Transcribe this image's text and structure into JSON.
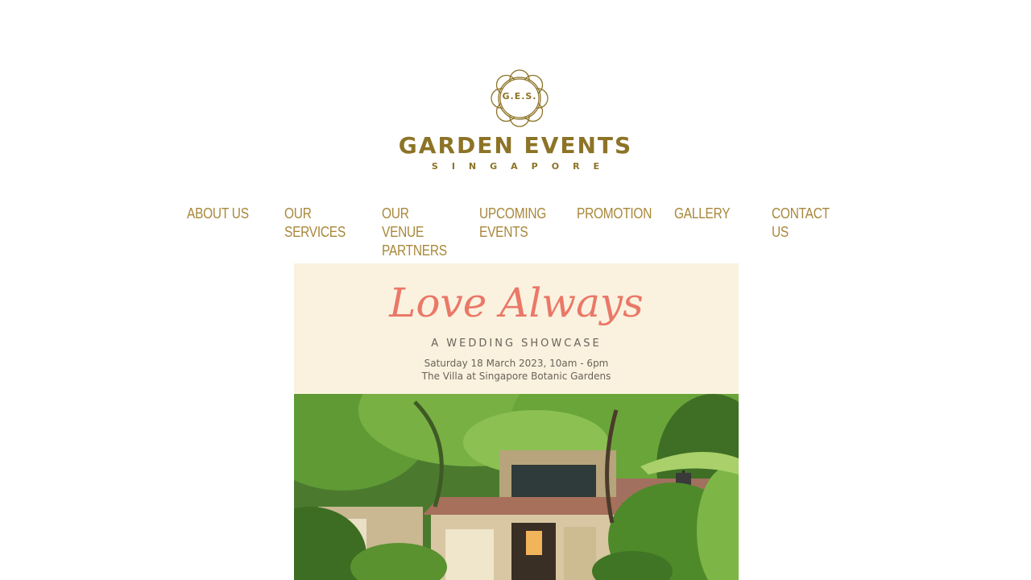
{
  "logo": {
    "initials": "G.E.S.",
    "name": "GARDEN EVENTS",
    "tagline": "SINGAPORE"
  },
  "nav": {
    "items": [
      {
        "label": "ABOUT US"
      },
      {
        "label": "OUR SERVICES"
      },
      {
        "label": "OUR VENUE PARTNERS"
      },
      {
        "label": "UPCOMING EVENTS"
      },
      {
        "label": "PROMOTION"
      },
      {
        "label": "GALLERY"
      },
      {
        "label": "CONTACT US"
      }
    ]
  },
  "hero": {
    "script_title": "Love Always",
    "subtitle": "A WEDDING SHOWCASE",
    "date_line": "Saturday 18 March 2023, 10am - 6pm",
    "venue_line": "The Villa at Singapore Botanic Gardens"
  },
  "colors": {
    "brand_gold": "#8c7326",
    "nav_gold": "#a8873a",
    "poster_cream": "#faf2df",
    "poster_coral": "#ea7868"
  }
}
